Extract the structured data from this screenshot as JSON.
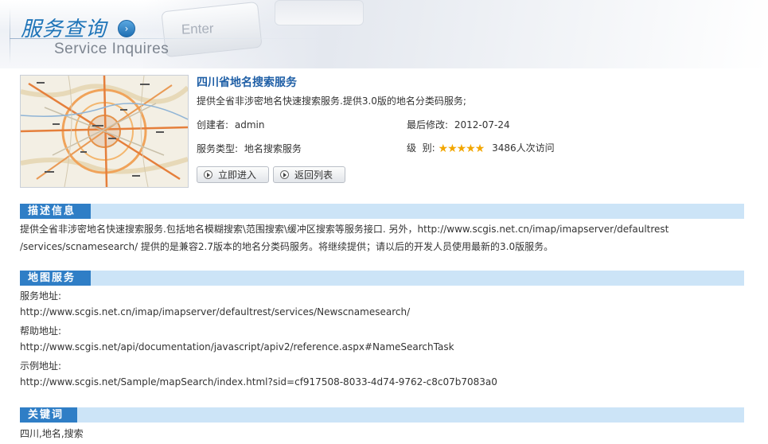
{
  "banner": {
    "title": "服务查询",
    "subtitle": "Service Inquires",
    "key_label": "Enter",
    "arrow_icon": "arrow-right-icon"
  },
  "service": {
    "title": "四川省地名搜索服务",
    "description": "提供全省非涉密地名快速搜索服务.提供3.0版的地名分类码服务;",
    "creator_label": "创建者:",
    "creator_value": "admin",
    "modified_label": "最后修改:",
    "modified_value": "2012-07-24",
    "type_label": "服务类型:",
    "type_value": "地名搜索服务",
    "level_label": "级  别:",
    "rating": 5,
    "stars": "★★★★★",
    "visits": "3486人次访问",
    "enter_button": "立即进入",
    "back_button": "返回列表"
  },
  "sections": {
    "description": {
      "label": "描述信息",
      "line1": "提供全省非涉密地名快速搜索服务.包括地名模糊搜索\\范围搜索\\缓冲区搜索等服务接口. 另外，http://www.scgis.net.cn/imap/imapserver/defaultrest",
      "line2": "/services/scnamesearch/ 提供的是兼容2.7版本的地名分类码服务。将继续提供；请以后的开发人员使用最新的3.0版服务。"
    },
    "map_service": {
      "label": "地图服务",
      "service_url_label": "服务地址:",
      "service_url": "http://www.scgis.net.cn/imap/imapserver/defaultrest/services/Newscnamesearch/",
      "help_url_label": "帮助地址:",
      "help_url": "http://www.scgis.net/api/documentation/javascript/apiv2/reference.aspx#NameSearchTask",
      "example_url_label": "示例地址:",
      "example_url": "http://www.scgis.net/Sample/mapSearch/index.html?sid=cf917508-8033-4d74-9762-c8c07b7083a0"
    },
    "keywords": {
      "label": "关键词",
      "value": "四川,地名,搜索"
    }
  },
  "colors": {
    "accent": "#2f7ec6",
    "section_bar": "#cce4f7",
    "title_blue": "#1f5fa6",
    "star": "#f2a600"
  }
}
